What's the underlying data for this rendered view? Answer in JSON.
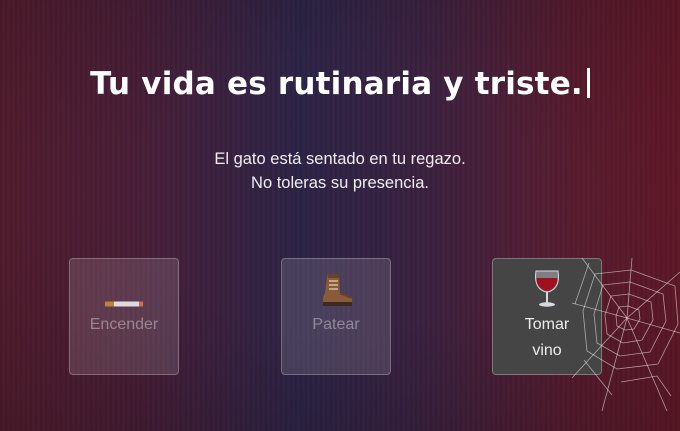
{
  "title": "Tu vida es rutinaria y triste.",
  "description": {
    "line1": "El gato está sentado en tu regazo.",
    "line2": "No toleras su presencia."
  },
  "choices": [
    {
      "label": "Encender",
      "icon": "cigarette-icon",
      "enabled": false
    },
    {
      "label": "Patear",
      "icon": "boot-icon",
      "enabled": false
    },
    {
      "label_line1": "Tomar",
      "label_line2": "vino",
      "icon": "wine-glass-icon",
      "enabled": true
    }
  ],
  "decoration": "spider-web",
  "colors": {
    "bg_left": "#5a1f32",
    "bg_center": "#2c2346",
    "bg_right": "#6a1a2c",
    "active_card": "#454545",
    "wine": "#9c1020"
  }
}
